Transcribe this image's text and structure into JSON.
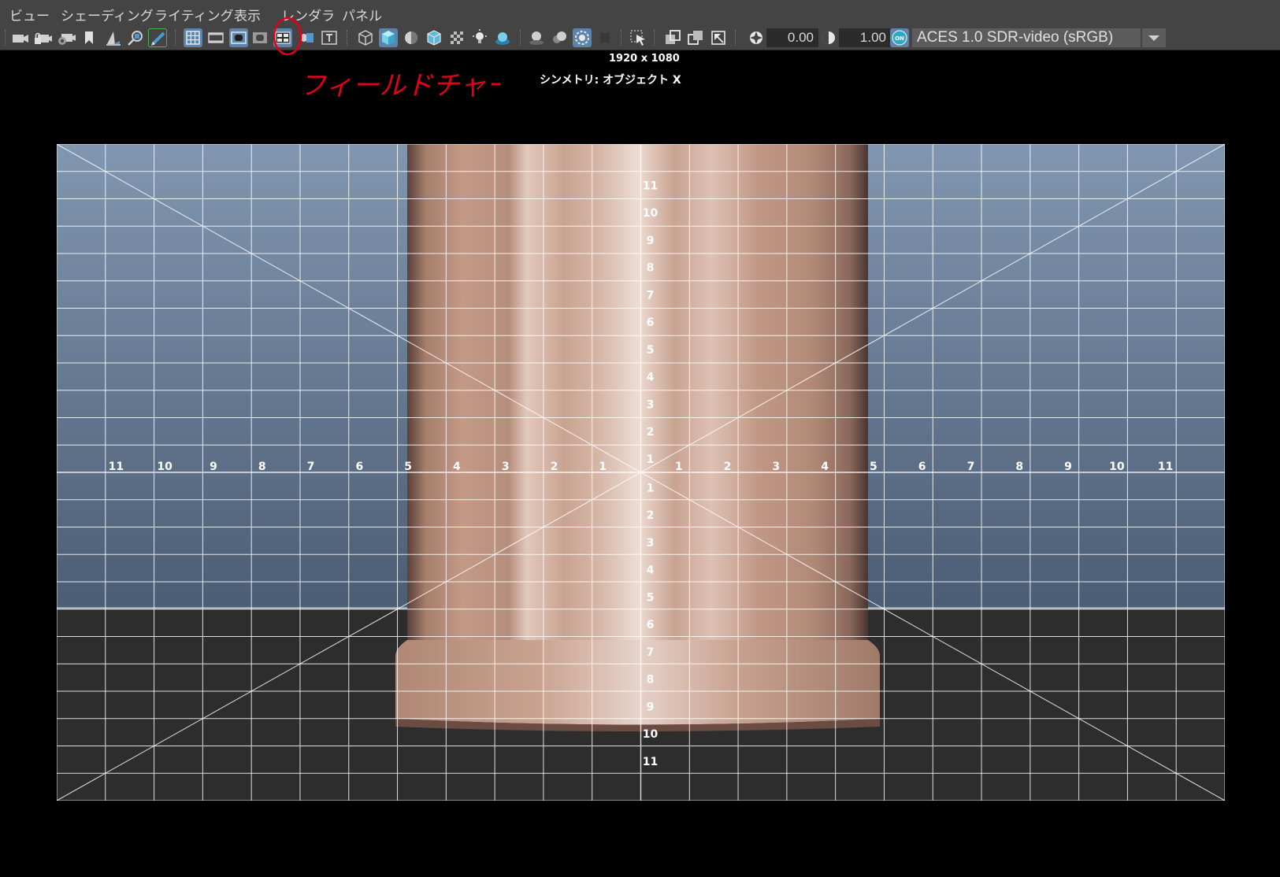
{
  "menu": {
    "items": [
      {
        "label": "ビュー"
      },
      {
        "label": "シェーディング"
      },
      {
        "label": "ライティング"
      },
      {
        "label": "表示"
      },
      {
        "label": "レンダラ"
      },
      {
        "label": "パネル"
      }
    ]
  },
  "toolbar": {
    "exposure_value": "0.00",
    "gamma_value": "1.00",
    "color_space": "ACES 1.0 SDR-video (sRGB)",
    "cm_toggle_label": "ON",
    "icons": [
      "select-camera-icon",
      "lock-camera-icon",
      "camera-attributes-icon",
      "bookmark-icon",
      "image-plane-icon",
      "2d-pan-zoom-icon",
      "grease-pencil-icon",
      "grid-icon",
      "film-gate-icon",
      "resolution-gate-icon",
      "gate-mask-icon",
      "field-chart-icon",
      "safe-action-icon",
      "safe-title-icon",
      "wireframe-icon",
      "smooth-shade-all-icon",
      "use-default-material-icon",
      "wireframe-on-shaded-icon",
      "xray-icon",
      "use-all-lights-icon",
      "shadows-icon",
      "screen-space-ao-icon",
      "motion-blur-icon",
      "multisample-aa-icon",
      "depth-of-field-icon",
      "isolate-select-icon",
      "xray-active-components-icon",
      "xray-joints-icon",
      "backface-culling-icon",
      "exposure-icon",
      "gamma-icon",
      "color-management-toggle-icon",
      "color-space-dropdown-arrow-icon"
    ]
  },
  "hud": {
    "resolution": "1920 x 1080",
    "symmetry": "シンメトリ: オブジェクト X"
  },
  "annotation": {
    "text": "フィールドチャート",
    "color": "#e0001b"
  },
  "colors": {
    "accent": "#5b84ab",
    "sky_top": "#8196b0",
    "sky_bottom": "#4b5d74",
    "ground": "#2d2d2d",
    "pillar": "#c99f8a"
  },
  "chart_data": {
    "type": "field-chart",
    "grid_columns": 24,
    "grid_rows": 24,
    "x_labels": [
      "11",
      "10",
      "9",
      "8",
      "7",
      "6",
      "5",
      "4",
      "3",
      "2",
      "1",
      "1",
      "2",
      "3",
      "4",
      "5",
      "6",
      "7",
      "8",
      "9",
      "10",
      "11"
    ],
    "y_labels_top": [
      "11",
      "10",
      "9",
      "8",
      "7",
      "6",
      "5",
      "4",
      "3",
      "2",
      "1"
    ],
    "y_labels_bottom": [
      "1",
      "2",
      "3",
      "4",
      "5",
      "6",
      "7",
      "8",
      "9",
      "10",
      "11"
    ],
    "diagonals": true
  }
}
